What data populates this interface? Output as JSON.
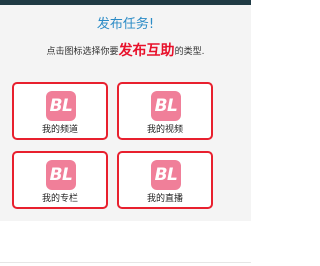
{
  "header": {
    "title": "发布任务!",
    "subtitle_before": "点击图标选择你要",
    "subtitle_emphasis": "发布互助",
    "subtitle_after": "的类型."
  },
  "options": [
    {
      "icon_text": "BL",
      "label": "我的频道"
    },
    {
      "icon_text": "BL",
      "label": "我的视频"
    },
    {
      "icon_text": "BL",
      "label": "我的专栏"
    },
    {
      "icon_text": "BL",
      "label": "我的直播"
    }
  ],
  "colors": {
    "title": "#2b8bc6",
    "emphasis": "#e8102a",
    "card_border": "#e8202e",
    "badge": "#f07f99"
  }
}
